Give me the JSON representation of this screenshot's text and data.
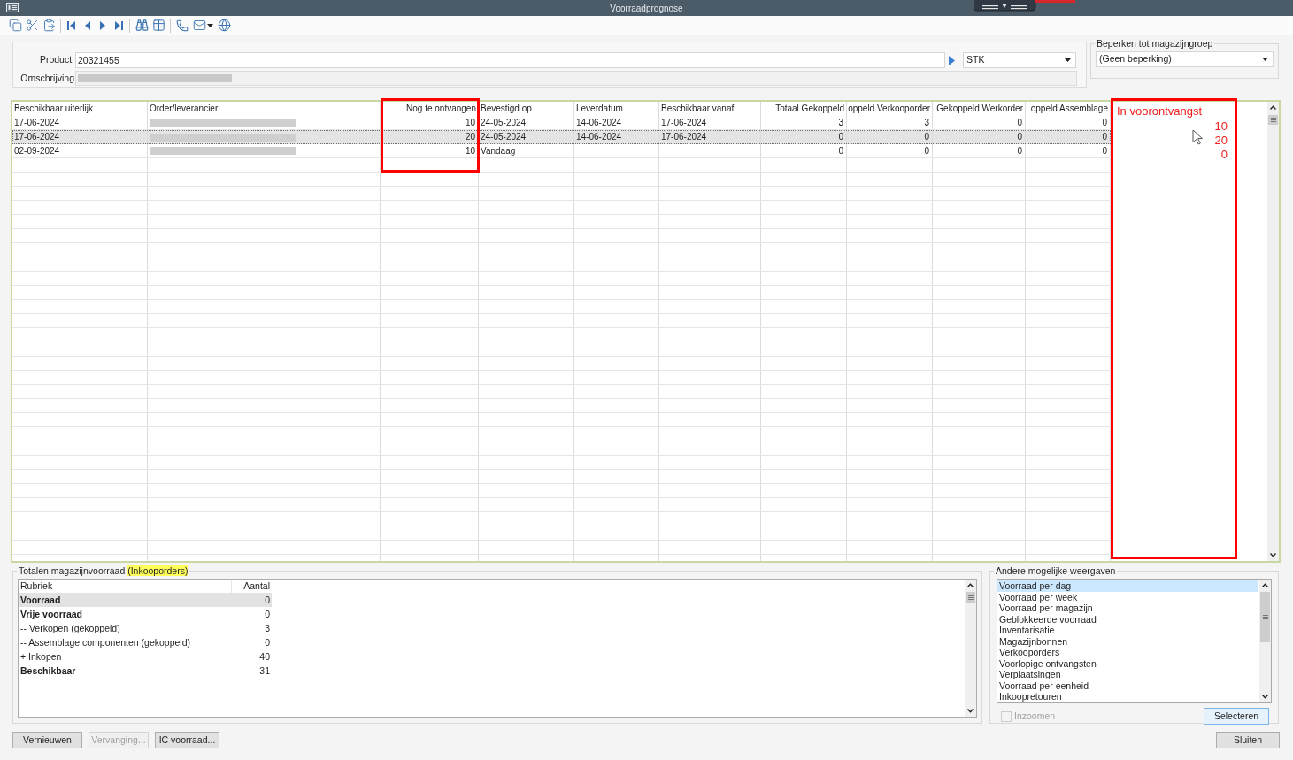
{
  "window": {
    "title": "Voorraadprognose"
  },
  "product": {
    "label": "Product:",
    "value": "20321455",
    "unit": "STK",
    "description_label": "Omschrijving"
  },
  "warehouse_group": {
    "title": "Beperken tot magazijngroep",
    "value": "(Geen beperking)"
  },
  "table": {
    "columns": [
      {
        "title": "Beschikbaar uiterlijk",
        "kind": "text"
      },
      {
        "title": "Order/leverancier",
        "kind": "blurred"
      },
      {
        "title": "Nog te ontvangen",
        "kind": "number"
      },
      {
        "title": "Bevestigd op",
        "kind": "text"
      },
      {
        "title": "Leverdatum",
        "kind": "text"
      },
      {
        "title": "Beschikbaar vanaf",
        "kind": "text"
      },
      {
        "title": "Totaal Gekoppeld",
        "kind": "number"
      },
      {
        "title": "oppeld Verkooporder",
        "kind": "number"
      },
      {
        "title": "Gekoppeld Werkorder",
        "kind": "number"
      },
      {
        "title": "oppeld Assemblage",
        "kind": "number"
      }
    ],
    "rows": [
      {
        "selected": false,
        "cells": [
          "17-06-2024",
          null,
          "10",
          "24-05-2024",
          "14-06-2024",
          "17-06-2024",
          "3",
          "3",
          "0",
          "0"
        ]
      },
      {
        "selected": true,
        "cells": [
          "17-06-2024",
          null,
          "20",
          "24-05-2024",
          "14-06-2024",
          "17-06-2024",
          "0",
          "0",
          "0",
          "0"
        ]
      },
      {
        "selected": false,
        "cells": [
          "02-09-2024",
          null,
          "10",
          "Vandaag",
          null,
          null,
          "0",
          "0",
          "0",
          "0"
        ]
      }
    ]
  },
  "annotation": {
    "title": "In voorontvangst",
    "values": [
      "10",
      "20",
      "0"
    ]
  },
  "stock_totals": {
    "title": "Totalen magazijnvoorraad",
    "title_highlight": "(Inkooporders)",
    "columns": [
      "Rubriek",
      "Aantal"
    ],
    "rows": [
      {
        "label": "Voorraad",
        "value": "0",
        "bold": true,
        "selected": true
      },
      {
        "label": "Vrije voorraad",
        "value": "0",
        "bold": true,
        "selected": false
      },
      {
        "label": "-- Verkopen (gekoppeld)",
        "value": "3",
        "bold": false,
        "selected": false
      },
      {
        "label": "-- Assemblage componenten (gekoppeld)",
        "value": "0",
        "bold": false,
        "selected": false
      },
      {
        "label": "+ Inkopen",
        "value": "40",
        "bold": false,
        "selected": false
      },
      {
        "label": "Beschikbaar",
        "value": "31",
        "bold": true,
        "selected": false
      }
    ]
  },
  "other_views": {
    "title": "Andere mogelijke weergaven",
    "items": [
      {
        "label": "Voorraad per dag",
        "selected": true
      },
      {
        "label": "Voorraad per week",
        "selected": false
      },
      {
        "label": "Voorraad per magazijn",
        "selected": false
      },
      {
        "label": "Geblokkeerde voorraad",
        "selected": false
      },
      {
        "label": "Inventarisatie",
        "selected": false
      },
      {
        "label": "Magazijnbonnen",
        "selected": false
      },
      {
        "label": "Verkooporders",
        "selected": false
      },
      {
        "label": "Voorlopige ontvangsten",
        "selected": false
      },
      {
        "label": "Verplaatsingen",
        "selected": false
      },
      {
        "label": "Voorraad per eenheid",
        "selected": false
      },
      {
        "label": "Inkoopretouren",
        "selected": false
      }
    ],
    "zoom": {
      "label": "Inzoomen",
      "checked": false,
      "disabled": true
    },
    "select_button": {
      "label": "Selecteren",
      "focused": true
    }
  },
  "buttons": [
    {
      "label": "Vernieuwen",
      "disabled": false
    },
    {
      "label": "Vervanging...",
      "disabled": true
    },
    {
      "label": "IC voorraad...",
      "disabled": false
    }
  ],
  "close_button": {
    "label": "Sluiten"
  }
}
